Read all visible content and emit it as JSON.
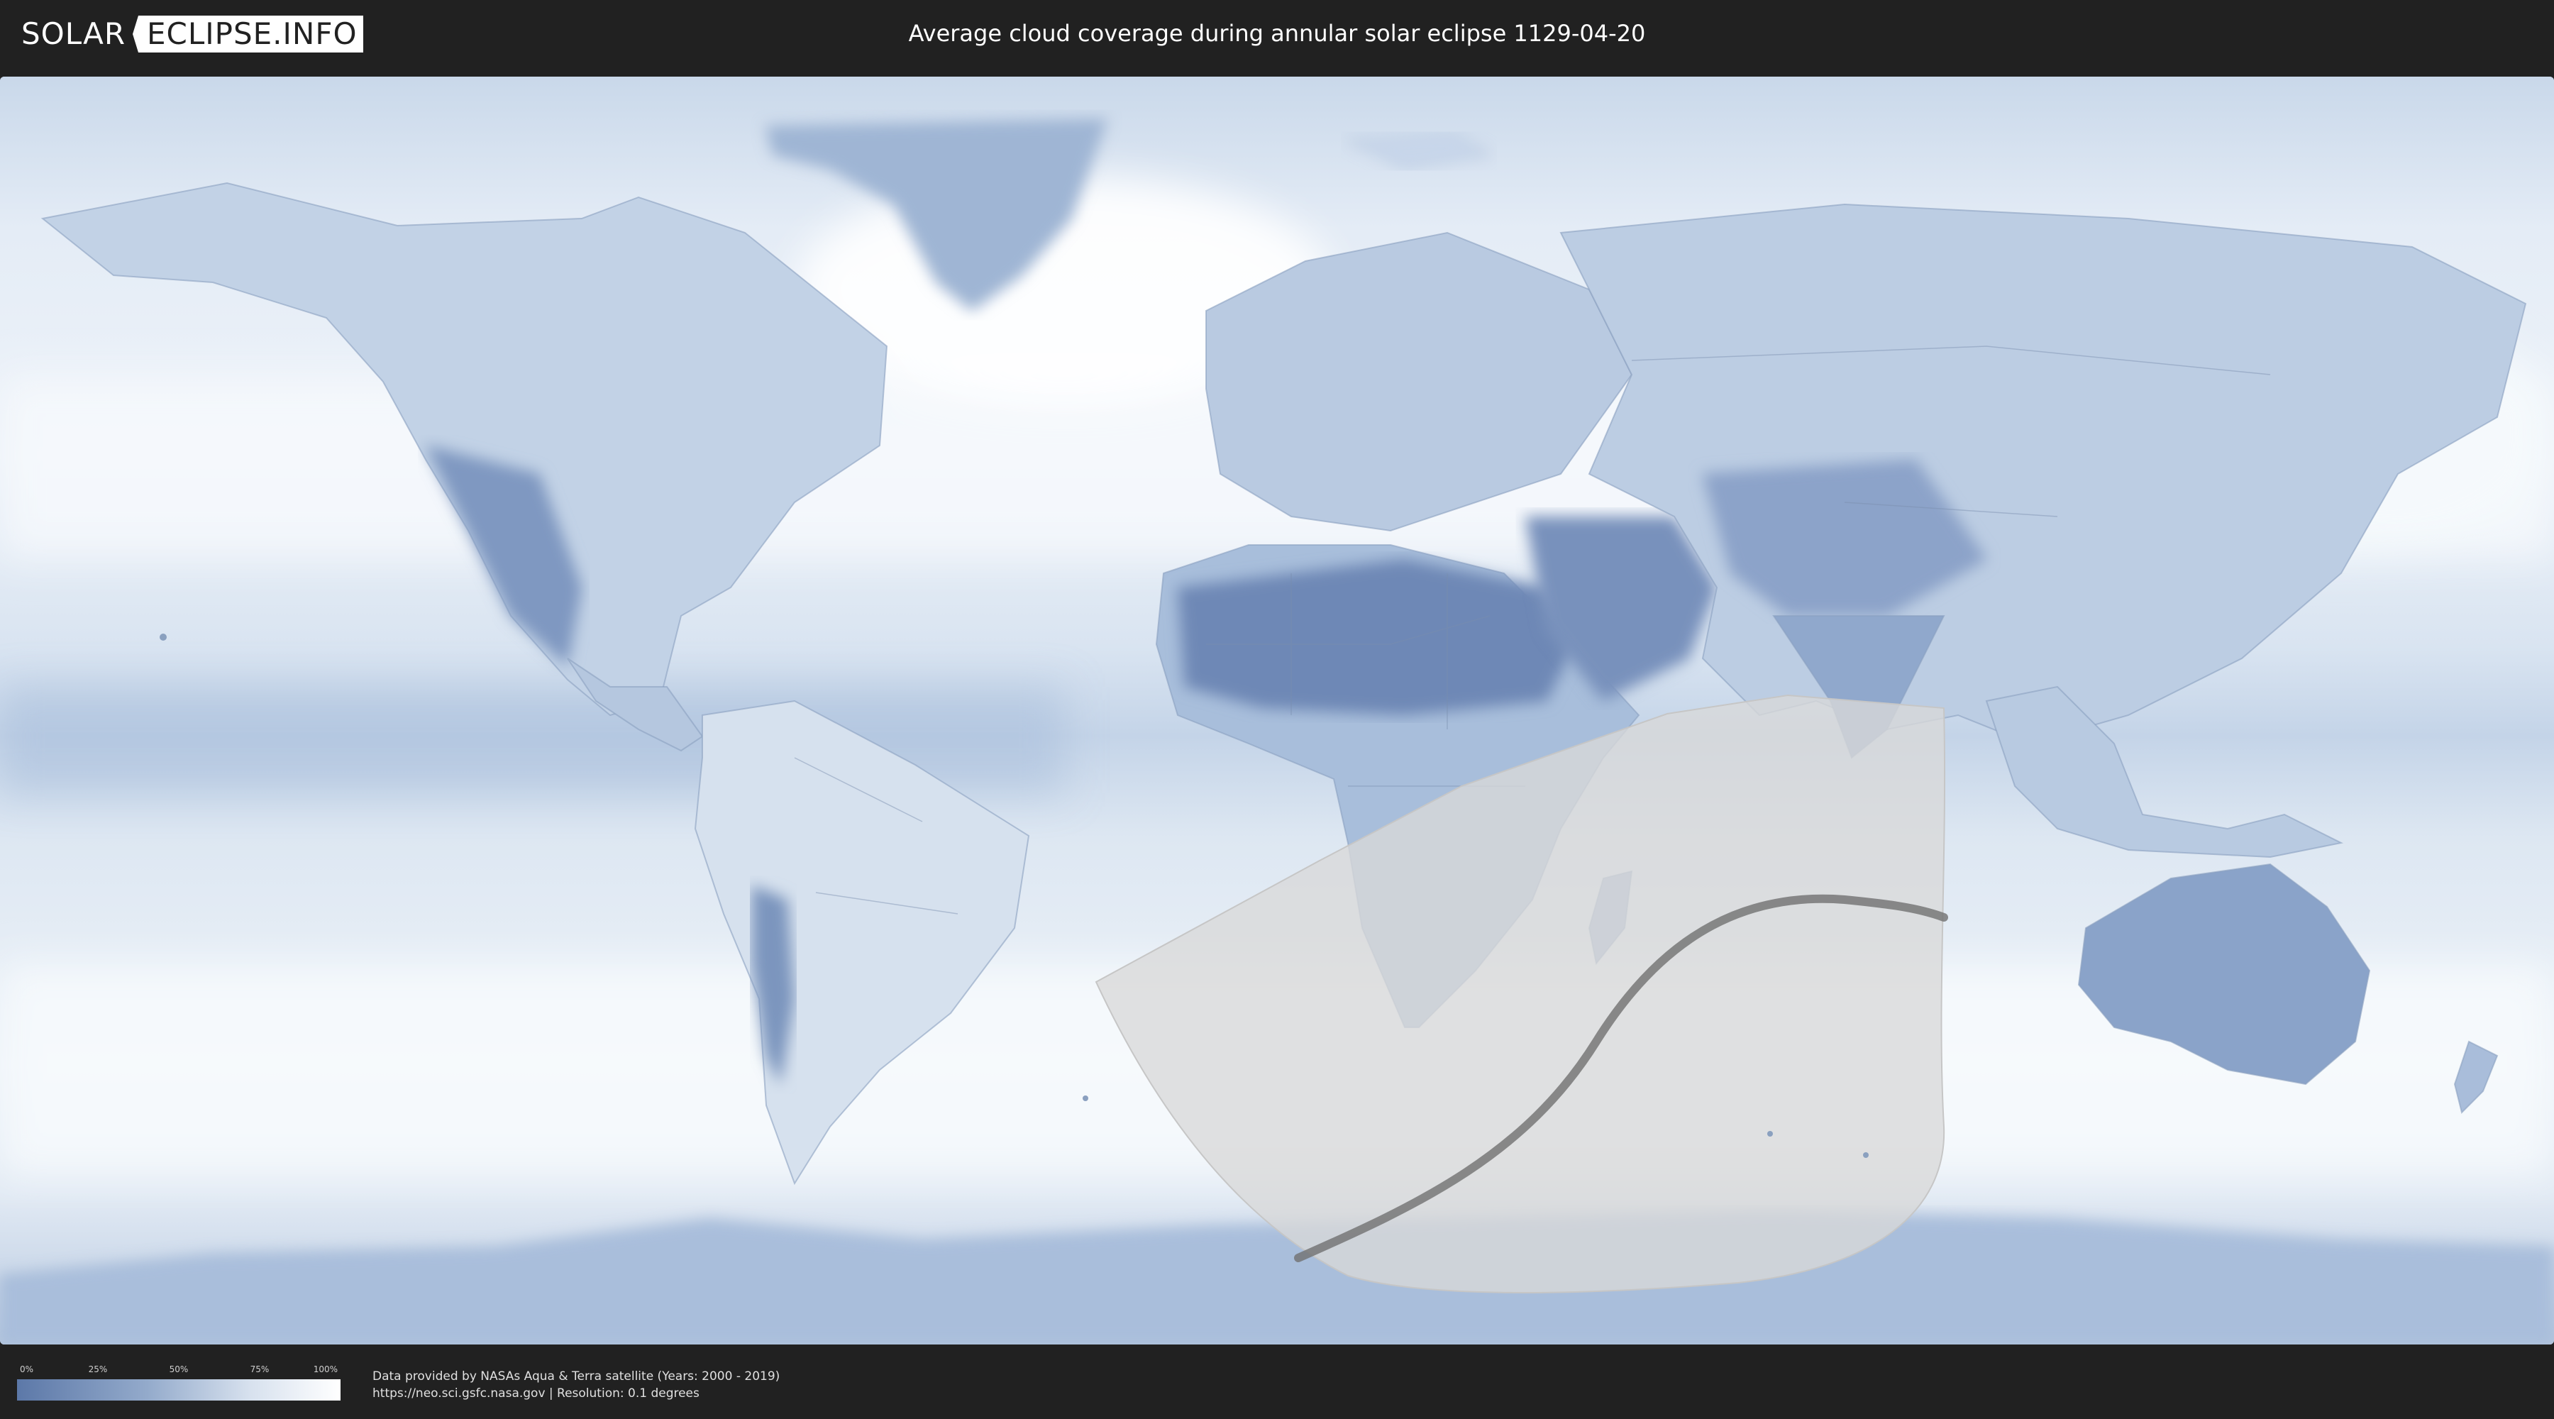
{
  "header": {
    "logo_left": "SOLAR",
    "logo_right": "ECLIPSE.INFO",
    "title": "Average cloud coverage during annular solar eclipse 1129-04-20"
  },
  "colors": {
    "background": "#212121",
    "ocean_light": "#e8eff7",
    "cloud_dense": "#ffffff",
    "land_clear": "#5c78a8",
    "eclipse_zone": "#d9d9d9",
    "central_path": "#606060"
  },
  "legend": {
    "ticks": [
      "0%",
      "25%",
      "50%",
      "75%",
      "100%"
    ],
    "gradient": [
      "#5c78a8",
      "#93aacb",
      "#d7e1ee",
      "#ffffff"
    ]
  },
  "credits": {
    "line1": "Data provided by NASAs Aqua & Terra satellite (Years: 2000 - 2019)",
    "line2": "https://neo.sci.gsfc.nasa.gov | Resolution: 0.1 degrees"
  }
}
